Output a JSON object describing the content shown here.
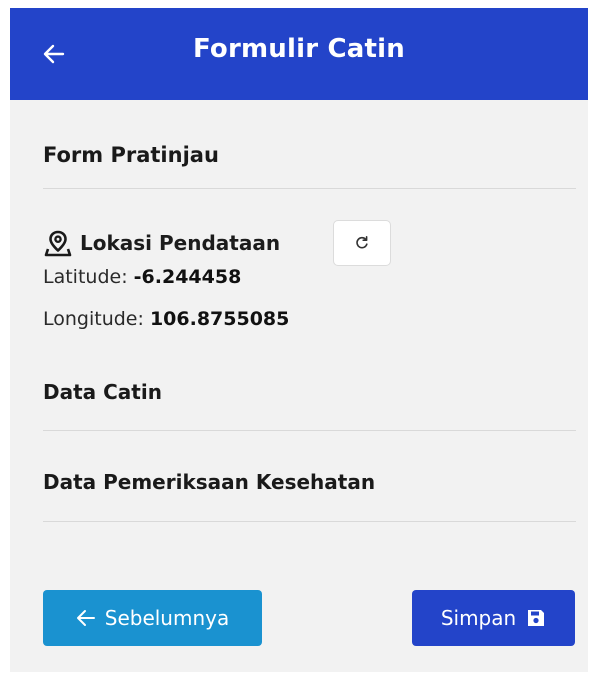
{
  "header": {
    "title": "Formulir Catin"
  },
  "form": {
    "title": "Form Pratinjau",
    "location": {
      "label": "Lokasi Pendataan",
      "latitude_label": "Latitude:",
      "latitude_value": "-6.244458",
      "longitude_label": "Longitude:",
      "longitude_value": "106.8755085"
    },
    "sections": [
      {
        "label": "Data Catin"
      },
      {
        "label": "Data Pemeriksaan Kesehatan"
      }
    ]
  },
  "actions": {
    "prev_label": "Sebelumnya",
    "save_label": "Simpan"
  },
  "colors": {
    "primary": "#2344c9",
    "secondary": "#1a92d0",
    "background": "#f2f2f2"
  },
  "icons": [
    "arrow-left-icon",
    "map-pin-icon",
    "refresh-icon",
    "save-icon"
  ]
}
